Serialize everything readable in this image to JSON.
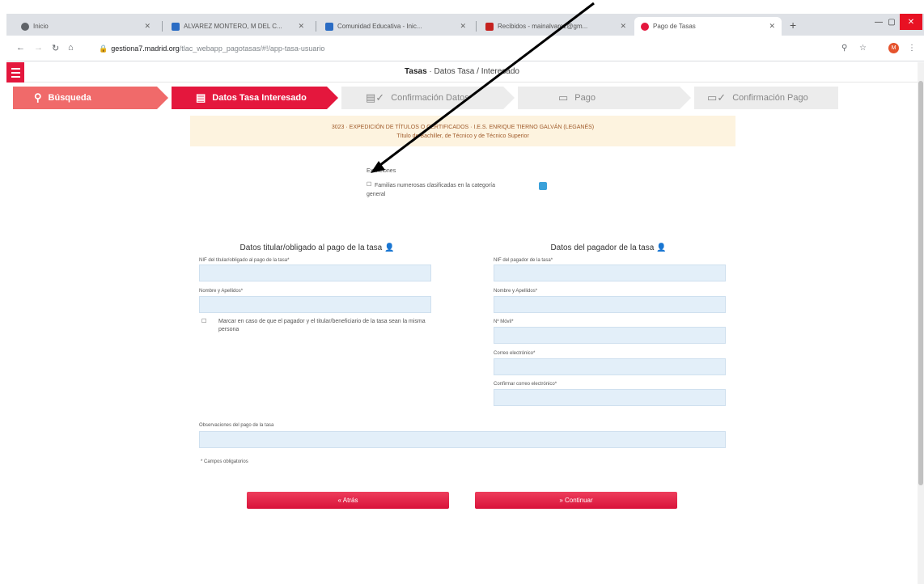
{
  "browser": {
    "tabs": [
      {
        "label": "Inicio",
        "active": false,
        "favicon_color": "#5f6368"
      },
      {
        "label": "ALVAREZ MONTERO, M DEL C...",
        "active": false,
        "favicon_color": "#2b6cc4"
      },
      {
        "label": "Comunidad Educativa - Inic...",
        "active": false,
        "favicon_color": "#2b6cc4"
      },
      {
        "label": "Recibidos - mainalvarez@gm...",
        "active": false,
        "favicon_color": "#c5221f"
      },
      {
        "label": "Pago de Tasas",
        "active": true,
        "favicon_color": "#e4173d"
      }
    ],
    "url_host": "gestiona7.madrid.org",
    "url_path": "/tlac_webapp_pagotasas/#!/app-tasa-usuario"
  },
  "header": {
    "title_bold": "Tasas",
    "title_rest": " · Datos Tasa / Interesado"
  },
  "steps": [
    {
      "label": "Búsqueda",
      "icon": "search-icon",
      "state": "done"
    },
    {
      "label": "Datos Tasa Interesado",
      "icon": "id-card-icon",
      "state": "active"
    },
    {
      "label": "Confirmación Datos",
      "icon": "id-card-check-icon",
      "state": "pending"
    },
    {
      "label": "Pago",
      "icon": "credit-card-icon",
      "state": "pending"
    },
    {
      "label": "Confirmación Pago",
      "icon": "credit-card-check-icon",
      "state": "pending"
    }
  ],
  "info": {
    "line1": "3023  ·  EXPEDICIÓN DE TÍTULOS O CERTIFICADOS  ·  I.E.S. ENRIQUE TIERNO GALVÁN (LEGANÉS)",
    "line2": "Título de Bachiller, de Técnico y de Técnico Superior"
  },
  "exenciones": {
    "title": "Exenciones",
    "option": "Familias numerosas clasificadas en la categoría general"
  },
  "titular": {
    "title": "Datos titular/obligado al pago de la tasa",
    "nif_label": "NIF del titular/obligado al pago de la tasa*",
    "nombre_label": "Nombre y Apellidos*",
    "check_label": "Marcar en caso de que el pagador y el titular/beneficiario de la tasa sean la misma persona"
  },
  "pagador": {
    "title": "Datos del pagador de la tasa",
    "nif_label": "NIF del pagador de la tasa*",
    "nombre_label": "Nombre y Apellidos*",
    "movil_label": "Nº Móvil*",
    "correo_label": "Correo electrónico*",
    "confirmar_label": "Confirmar correo electrónico*"
  },
  "observaciones_label": "Observaciones del pago de la tasa",
  "required_note": "* Campos obligatorios",
  "buttons": {
    "back": "« Atrás",
    "continue": "» Continuar"
  },
  "colors": {
    "brand_red": "#e4173d",
    "done_step": "#f06a6a",
    "field_bg": "#e3eff9",
    "info_bg": "#fdf3df"
  }
}
